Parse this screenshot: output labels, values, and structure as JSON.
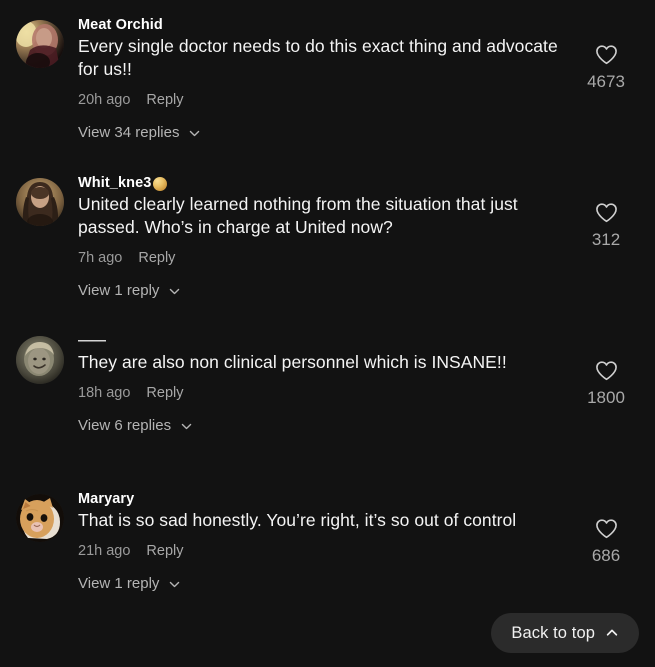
{
  "theme": {
    "background": "#121212",
    "text_primary": "#f4f4f4",
    "text_secondary": "#9e9e9e",
    "pill_background": "#2b2b2b"
  },
  "comments": [
    {
      "username": "Meat Orchid",
      "username_emoji": "",
      "text": "Every single doctor needs to do this exact thing and advocate for us!!",
      "time": "20h ago",
      "reply_label": "Reply",
      "view_replies_label": "View 34 replies",
      "like_count": "4673",
      "like_icon": "heart-outline-icon",
      "expand_icon": "chevron-down-icon",
      "avatar_name": "avatar-meat-orchid"
    },
    {
      "username": "Whit_kne3",
      "username_emoji": "potato-emoji",
      "text": "United clearly learned nothing from the situation that just passed. Who’s in charge at United now?",
      "time": "7h ago",
      "reply_label": "Reply",
      "view_replies_label": "View 1 reply",
      "like_count": "312",
      "like_icon": "heart-outline-icon",
      "expand_icon": "chevron-down-icon",
      "avatar_name": "avatar-whit-kne3"
    },
    {
      "username": "——",
      "username_emoji": "",
      "text": "They are also non clinical personnel which is INSANE!!",
      "time": "18h ago",
      "reply_label": "Reply",
      "view_replies_label": "View 6 replies",
      "like_count": "1800",
      "like_icon": "heart-outline-icon",
      "expand_icon": "chevron-down-icon",
      "avatar_name": "avatar-redacted-user"
    },
    {
      "username": "Maryary",
      "username_emoji": "",
      "text": "That is so sad honestly. You’re right, it’s so out of control",
      "time": "21h ago",
      "reply_label": "Reply",
      "view_replies_label": "View 1 reply",
      "like_count": "686",
      "like_icon": "heart-outline-icon",
      "expand_icon": "chevron-down-icon",
      "avatar_name": "avatar-maryary"
    }
  ],
  "back_to_top": {
    "label": "Back to top",
    "icon": "chevron-up-icon"
  }
}
